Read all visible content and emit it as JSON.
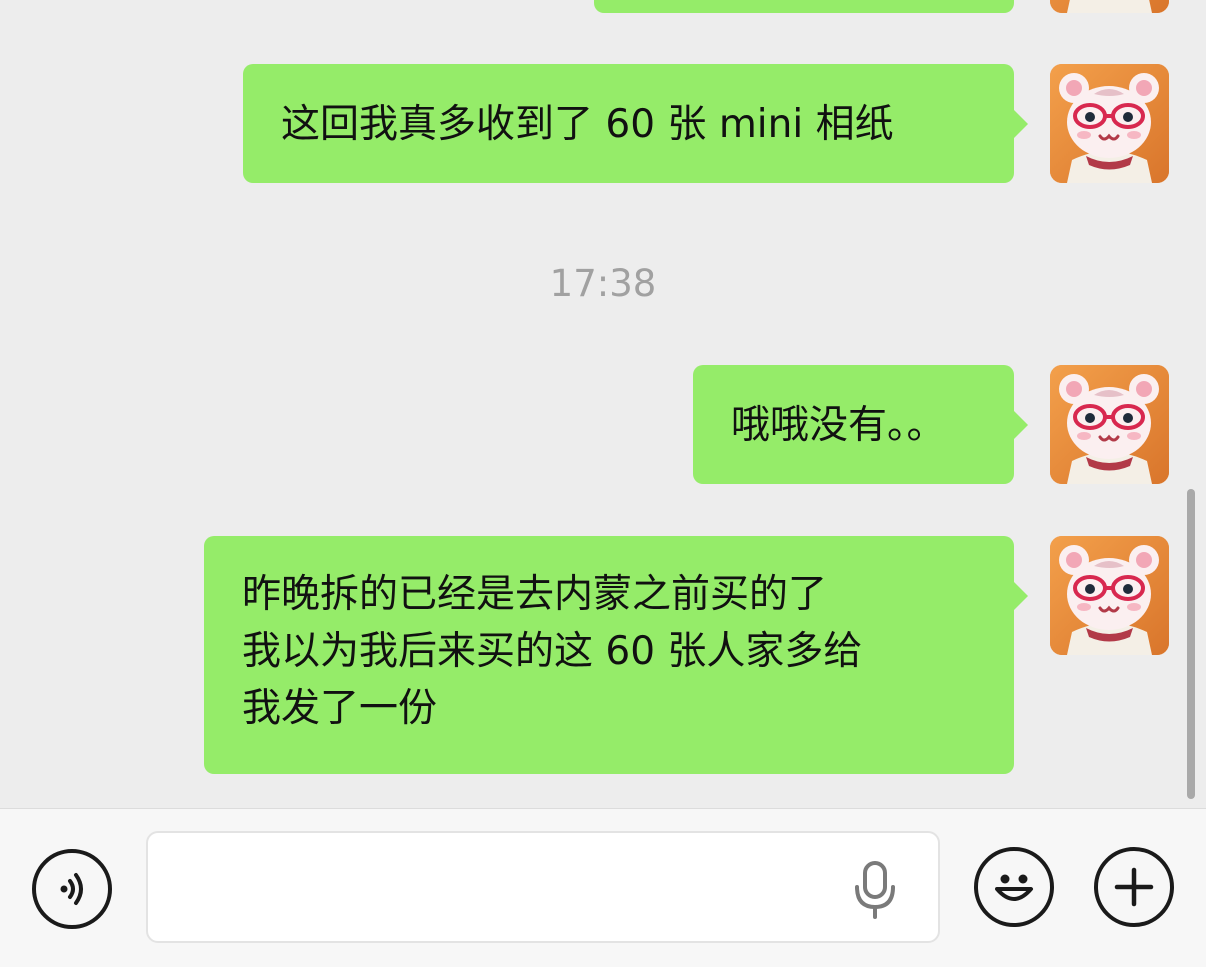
{
  "chat": {
    "messages": [
      {
        "sender": "self",
        "text": "这回我真多收到了 60 张 mini 相纸"
      },
      {
        "sender": "self",
        "text": "哦哦没有。。"
      },
      {
        "sender": "self",
        "text": "昨晚拆的已经是去内蒙之前买的了\n我以为我后来买的这 60 张人家多给\n我发了一份"
      }
    ],
    "timestamp": "17:38"
  },
  "input_bar": {
    "voice_icon": "voice-toggle-icon",
    "mic_icon": "microphone-icon",
    "emoji_icon": "emoji-icon",
    "plus_icon": "plus-icon",
    "input_value": ""
  },
  "colors": {
    "background": "#ededed",
    "bubble_self": "#95ec69",
    "timestamp": "#a1a1a1",
    "input_bar_bg": "#f7f7f7"
  }
}
